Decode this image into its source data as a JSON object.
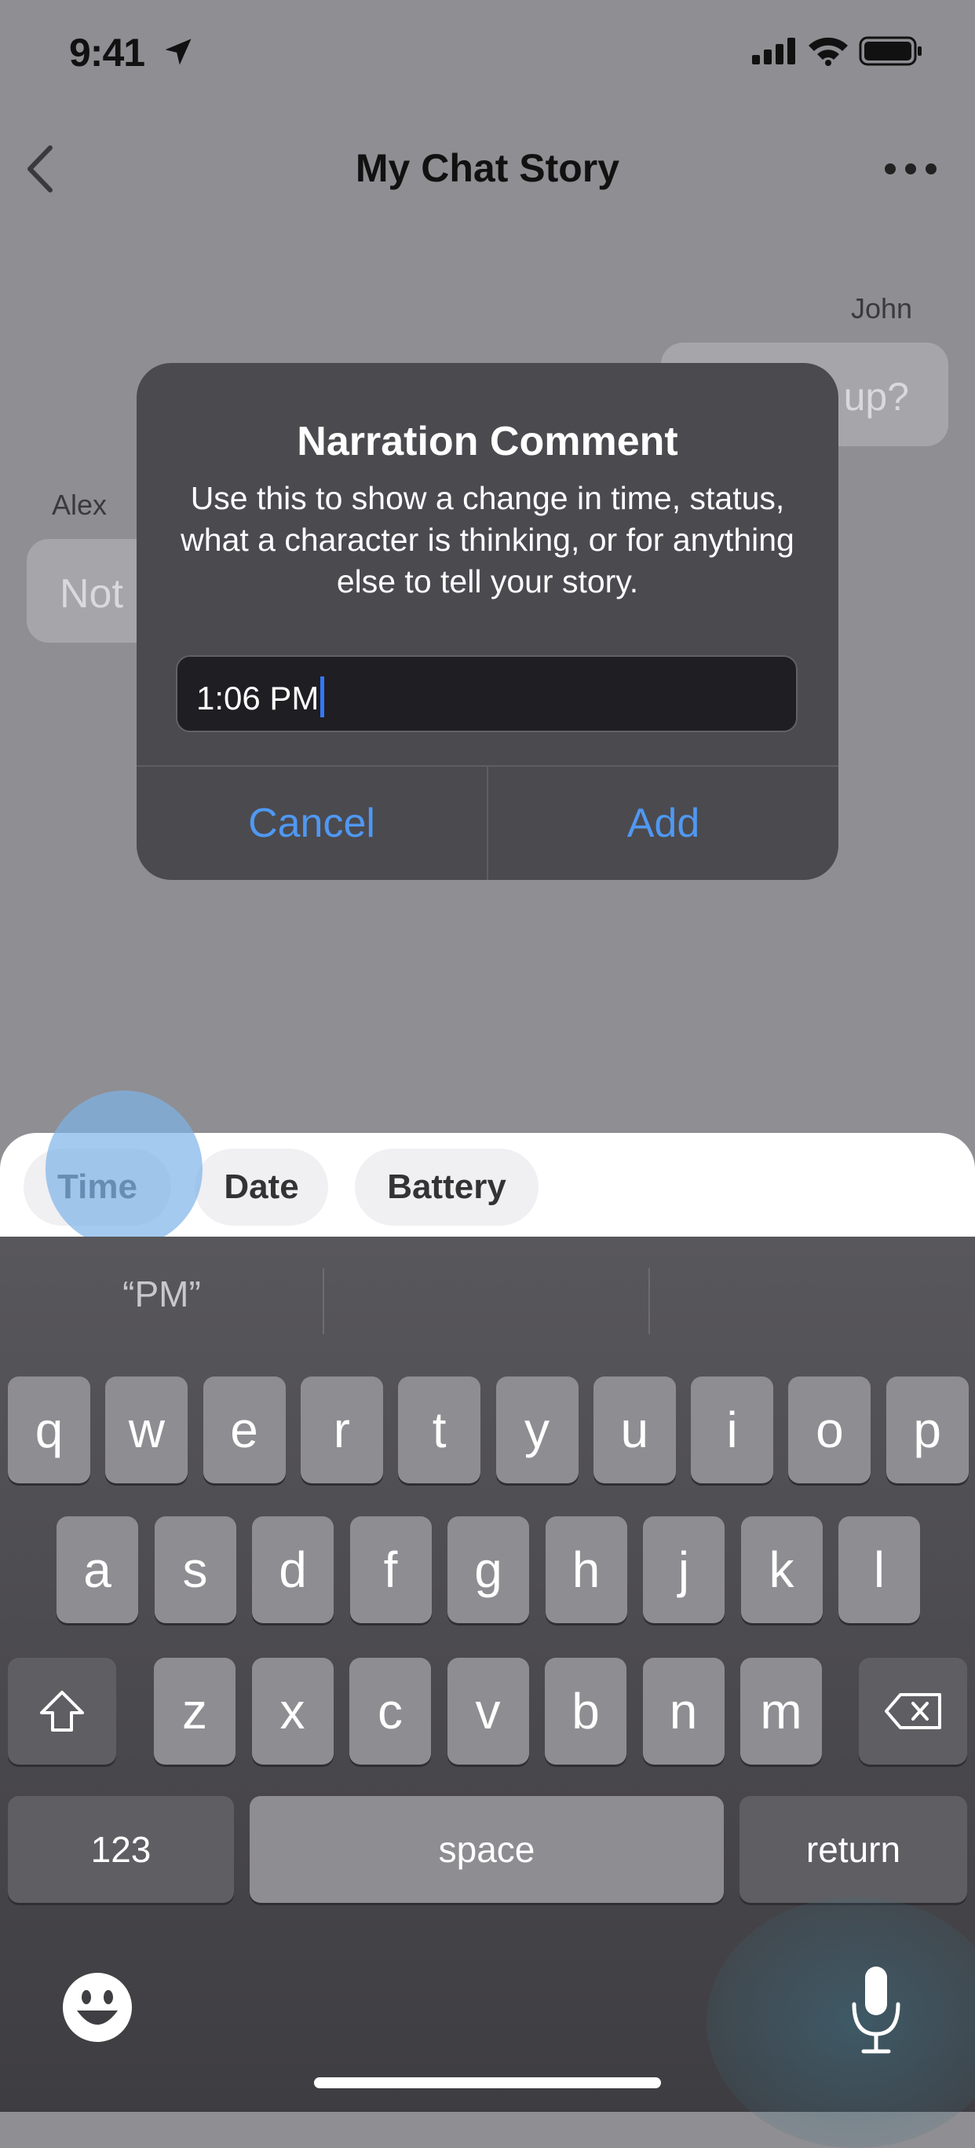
{
  "status_bar": {
    "time": "9:41"
  },
  "nav": {
    "title": "My Chat Story"
  },
  "chat": {
    "messages": [
      {
        "sender": "John",
        "text": "up?"
      },
      {
        "sender": "Alex",
        "text": "Not"
      }
    ]
  },
  "alert": {
    "title": "Narration Comment",
    "message": "Use this to show a change in time, status, what a character is thinking, or for anything else to tell your story.",
    "field_value": "1:06 PM",
    "cancel_label": "Cancel",
    "add_label": "Add"
  },
  "suggestions": {
    "chips": [
      "Time",
      "Date",
      "Battery"
    ]
  },
  "keyboard": {
    "predictions": [
      "“PM”",
      "",
      ""
    ],
    "row1": [
      "q",
      "w",
      "e",
      "r",
      "t",
      "y",
      "u",
      "i",
      "o",
      "p"
    ],
    "row2": [
      "a",
      "s",
      "d",
      "f",
      "g",
      "h",
      "j",
      "k",
      "l"
    ],
    "row3": [
      "z",
      "x",
      "c",
      "v",
      "b",
      "n",
      "m"
    ],
    "numbers_label": "123",
    "space_label": "space",
    "return_label": "return"
  },
  "colors": {
    "accent": "#4f98f2",
    "cursor": "#3478f6"
  }
}
